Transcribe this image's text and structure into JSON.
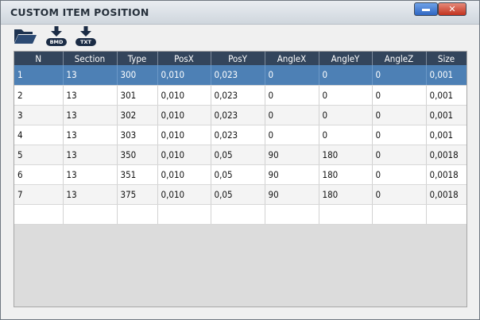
{
  "window": {
    "title": "CUSTOM ITEM POSITION",
    "minimize_label": "",
    "close_label": "✕"
  },
  "toolbar": {
    "open_icon": "folder-open-icon",
    "bmd_label": "BMD",
    "txt_label": "TXT"
  },
  "table": {
    "columns": [
      "N",
      "Section",
      "Type",
      "PosX",
      "PosY",
      "AngleX",
      "AngleY",
      "AngleZ",
      "Size"
    ],
    "rows": [
      [
        "1",
        "13",
        "300",
        "0,010",
        "0,023",
        "0",
        "0",
        "0",
        "0,001"
      ],
      [
        "2",
        "13",
        "301",
        "0,010",
        "0,023",
        "0",
        "0",
        "0",
        "0,001"
      ],
      [
        "3",
        "13",
        "302",
        "0,010",
        "0,023",
        "0",
        "0",
        "0",
        "0,001"
      ],
      [
        "4",
        "13",
        "303",
        "0,010",
        "0,023",
        "0",
        "0",
        "0",
        "0,001"
      ],
      [
        "5",
        "13",
        "350",
        "0,010",
        "0,05",
        "90",
        "180",
        "0",
        "0,0018"
      ],
      [
        "6",
        "13",
        "351",
        "0,010",
        "0,05",
        "90",
        "180",
        "0",
        "0,0018"
      ],
      [
        "7",
        "13",
        "375",
        "0,010",
        "0,05",
        "90",
        "180",
        "0",
        "0,0018"
      ]
    ],
    "selected_row": 0
  },
  "colors": {
    "header_bg": "#33455c",
    "selected_row_bg": "#4d80b5"
  }
}
